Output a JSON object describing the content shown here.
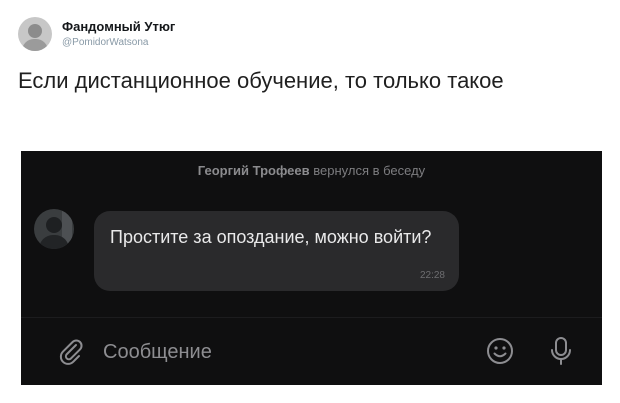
{
  "tweet": {
    "author": {
      "display_name": "Фандомный Утюг",
      "handle": "@PomidorWatsona"
    },
    "text": "Если дистанционное обучение, то только такое"
  },
  "chat": {
    "system_message": {
      "name": "Георгий Трофеев",
      "action": "вернулся в беседу"
    },
    "message": {
      "text": "Простите за опоздание, можно войти?",
      "time": "22:28"
    },
    "composer": {
      "placeholder": "Сообщение",
      "icons": [
        "paperclip-icon",
        "emoji-icon",
        "microphone-icon"
      ]
    }
  }
}
